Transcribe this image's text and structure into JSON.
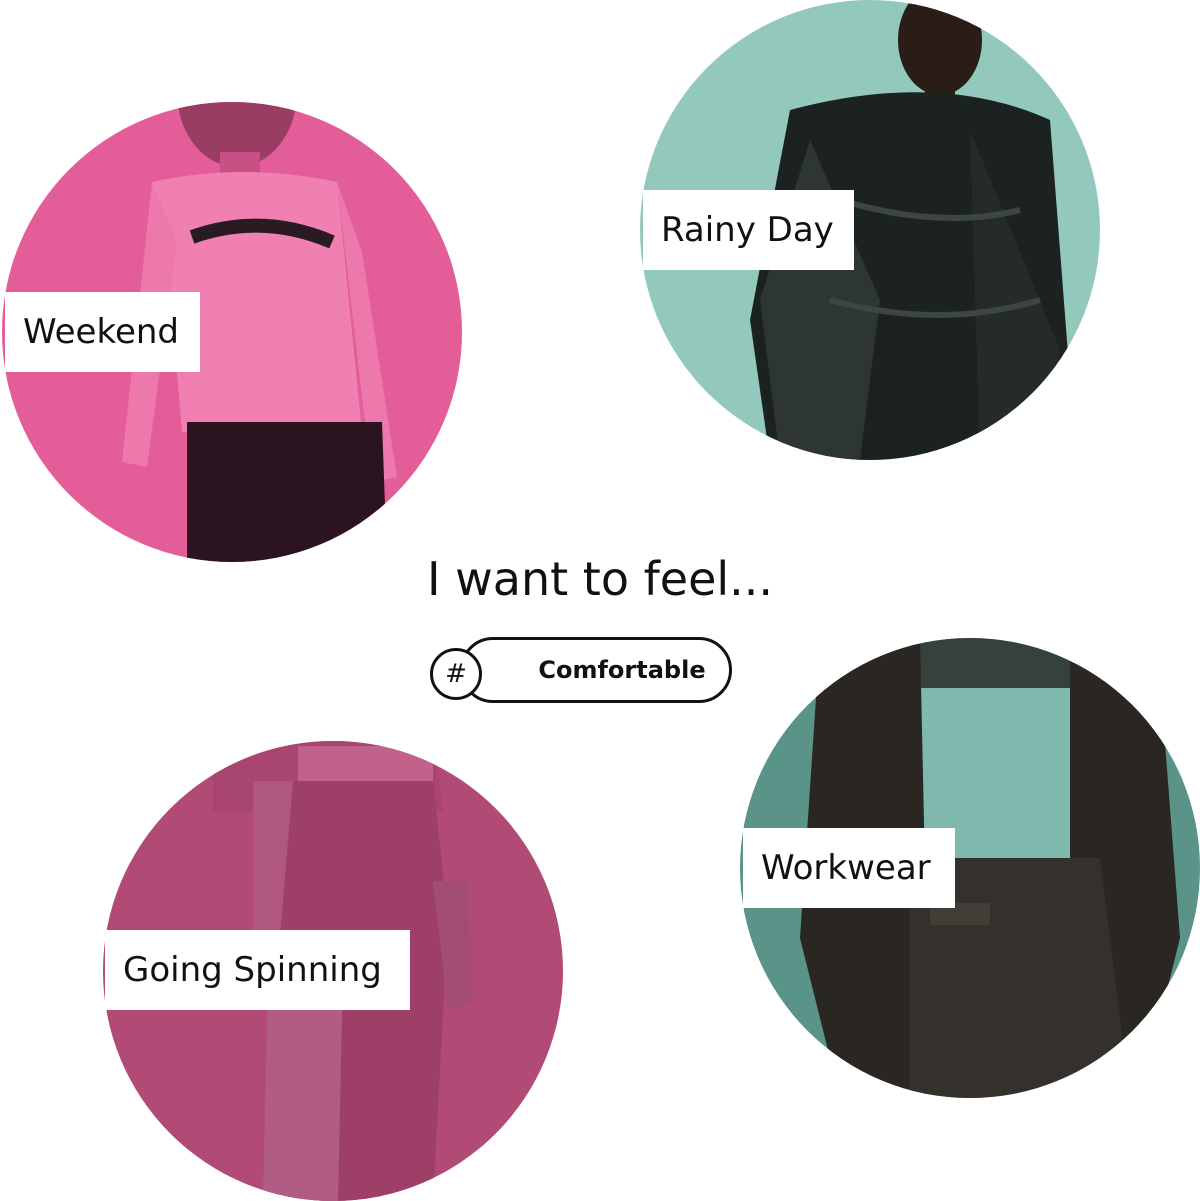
{
  "headline": "I want to feel...",
  "tag": {
    "symbol": "#",
    "label": "Comfortable"
  },
  "tiles": [
    {
      "label": "Weekend",
      "color": "#e35e99"
    },
    {
      "label": "Rainy Day",
      "color": "#93c9bc"
    },
    {
      "label": "Going Spinning",
      "color": "#b14a74"
    },
    {
      "label": "Workwear",
      "color": "#5a9387"
    }
  ]
}
